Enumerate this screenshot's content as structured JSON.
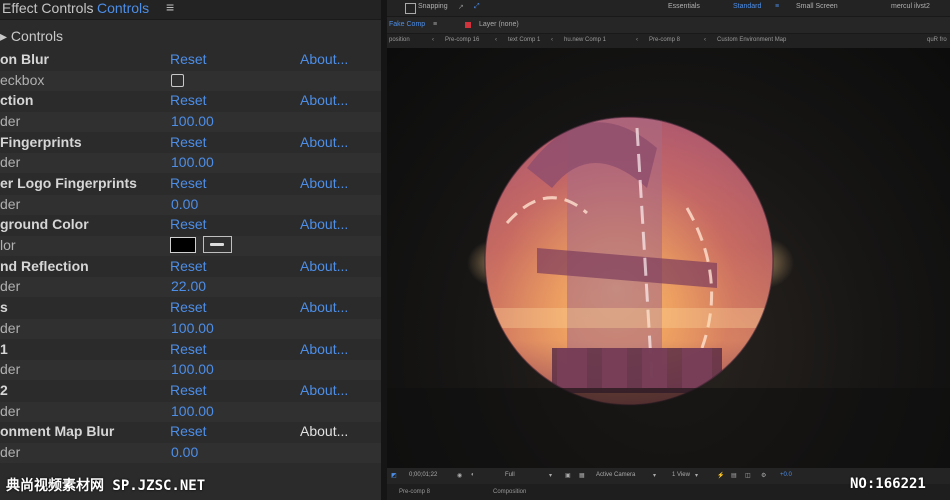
{
  "panel": {
    "tab1": "Effect Controls",
    "tab2": "Controls",
    "controls_label": "Controls",
    "rows": [
      {
        "name": "on Blur",
        "reset": "Reset",
        "about": "About...",
        "type": "header"
      },
      {
        "name": "eckbox",
        "type": "checkbox"
      },
      {
        "name": "ction",
        "reset": "Reset",
        "about": "About...",
        "type": "header"
      },
      {
        "name": "der",
        "value": "100.00",
        "type": "slider"
      },
      {
        "name": " Fingerprints",
        "reset": "Reset",
        "about": "About...",
        "type": "header"
      },
      {
        "name": "der",
        "value": "100.00",
        "type": "slider"
      },
      {
        "name": "er Logo Fingerprints",
        "reset": "Reset",
        "about": "About...",
        "type": "header"
      },
      {
        "name": "der",
        "value": "0.00",
        "type": "slider"
      },
      {
        "name": "ground Color",
        "reset": "Reset",
        "about": "About...",
        "type": "header"
      },
      {
        "name": "lor",
        "type": "color"
      },
      {
        "name": "nd Reflection",
        "reset": "Reset",
        "about": "About...",
        "type": "header"
      },
      {
        "name": "der",
        "value": "22.00",
        "type": "slider"
      },
      {
        "name": "s",
        "reset": "Reset",
        "about": "About...",
        "type": "header"
      },
      {
        "name": "der",
        "value": "100.00",
        "type": "slider"
      },
      {
        "name": " 1",
        "reset": "Reset",
        "about": "About...",
        "type": "header"
      },
      {
        "name": "der",
        "value": "100.00",
        "type": "slider"
      },
      {
        "name": " 2",
        "reset": "Reset",
        "about": "About...",
        "type": "header"
      },
      {
        "name": "der",
        "value": "100.00",
        "type": "slider"
      },
      {
        "name": "onment Map Blur",
        "reset": "Reset",
        "about": "About...",
        "type": "header",
        "about_white": true
      },
      {
        "name": "der",
        "value": "0.00",
        "type": "slider"
      }
    ]
  },
  "topbar": {
    "snapping": "Snapping",
    "essentials": "Essentials",
    "standard": "Standard",
    "small_screen": "Small Screen",
    "right_label": "mercul ilvst2"
  },
  "comp_bar": {
    "comp_tab": "Fake Comp",
    "layer": "Layer (none)"
  },
  "breadcrumbs": [
    "position",
    "Pre-comp 16",
    "text Comp 1",
    "hu.new Comp 1",
    "Pre-comp 8",
    "Custom Environment Map",
    "quR fro"
  ],
  "viewer_bar": {
    "timecode": "0;00;01;22",
    "quality": "Full",
    "camera": "Active Camera",
    "view": "1 View",
    "offset": "+0.0"
  },
  "bottom_tabs": [
    "Pre-comp 8",
    "Composition"
  ],
  "watermark_left": "典尚视频素材网 SP.JZSC.NET",
  "watermark_right": "NO:166221"
}
